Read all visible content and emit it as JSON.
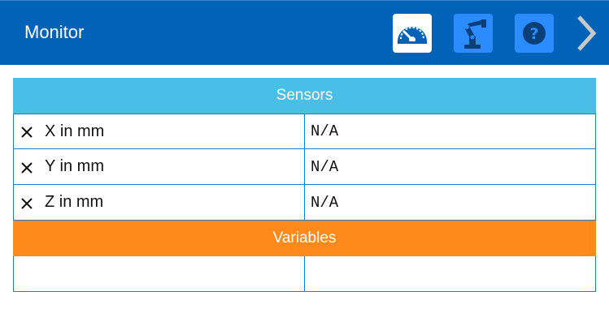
{
  "header": {
    "title": "Monitor",
    "buttons": [
      {
        "name": "monitor",
        "icon": "speedometer-icon"
      },
      {
        "name": "robot",
        "icon": "robot-arm-icon"
      },
      {
        "name": "help",
        "icon": "question-mark-icon"
      },
      {
        "name": "next",
        "icon": "chevron-right-icon"
      }
    ]
  },
  "sensors": {
    "title": "Sensors",
    "rows": [
      {
        "label": "X in mm",
        "value": "N/A"
      },
      {
        "label": "Y in mm",
        "value": "N/A"
      },
      {
        "label": "Z in mm",
        "value": "N/A"
      }
    ]
  },
  "variables": {
    "title": "Variables",
    "rows": [
      {
        "label": "",
        "value": ""
      }
    ]
  },
  "colors": {
    "header_bg": "#0063b8",
    "button_blue": "#2b8cff",
    "sensors_header": "#4bbee8",
    "variables_header": "#ff8a1c",
    "cell_border": "#1a7fd4"
  }
}
